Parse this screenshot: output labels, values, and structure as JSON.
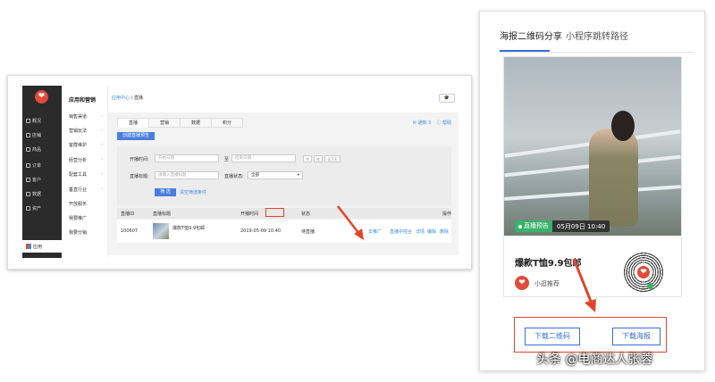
{
  "admin": {
    "sidebar": {
      "items": [
        "概况",
        "店铺",
        "商品",
        "订单",
        "客户",
        "数据",
        "资产"
      ],
      "bottom_label": "应用"
    },
    "subnav": {
      "title": "应用和营销",
      "items": [
        "销售渠道",
        "营销玩法",
        "客群维护",
        "经营分析",
        "配套工具",
        "垂直行业",
        "开放服务",
        "我要推广",
        "我要分销"
      ]
    },
    "breadcrumb": {
      "parent": "应用中心",
      "sep": " / ",
      "current": "直播"
    },
    "tabs": [
      "直播",
      "营销",
      "数据",
      "积分"
    ],
    "tab_links": {
      "notice": "通知 3",
      "help": "帮助"
    },
    "create_button": "创建直播预告",
    "filter": {
      "start_label": "开播时间:",
      "start_placeholder": "开始日期",
      "to_label": "至",
      "end_placeholder": "结束日期",
      "quick_ranges": [
        "今",
        "昨",
        "近7天"
      ],
      "title_label": "直播标题:",
      "title_placeholder": "请输入直播标题",
      "status_label": "直播状态:",
      "status_value": "全部",
      "filter_button": "筛 选",
      "clear_link": "清空筛选条件"
    },
    "table": {
      "headers": [
        "直播ID",
        "直播标题",
        "开播时间",
        "状态",
        "操作"
      ],
      "row": {
        "id": "100607",
        "title": "爆款T恤9.9包邮",
        "time": "2019-05-09 10:40",
        "status": "待直播",
        "ops": [
          "去推广",
          "直播中控台",
          "详情",
          "编辑",
          "删除"
        ]
      }
    }
  },
  "share": {
    "tabs": [
      "海报二维码分享",
      "小程序跳转路径"
    ],
    "poster": {
      "badge_status": "直播预告",
      "badge_time": "05月09日 10:40",
      "title": "爆款T恤9.9包邮",
      "shop_name": "小逛推荐"
    },
    "buttons": {
      "download_qr": "下载二维码",
      "download_poster": "下载海报"
    }
  },
  "watermark": "头条 @电商达人张蓉",
  "colors": {
    "accent": "#3a6ed8",
    "highlight": "#e0452c",
    "live": "#38b36a",
    "brand": "#e14b3b"
  }
}
